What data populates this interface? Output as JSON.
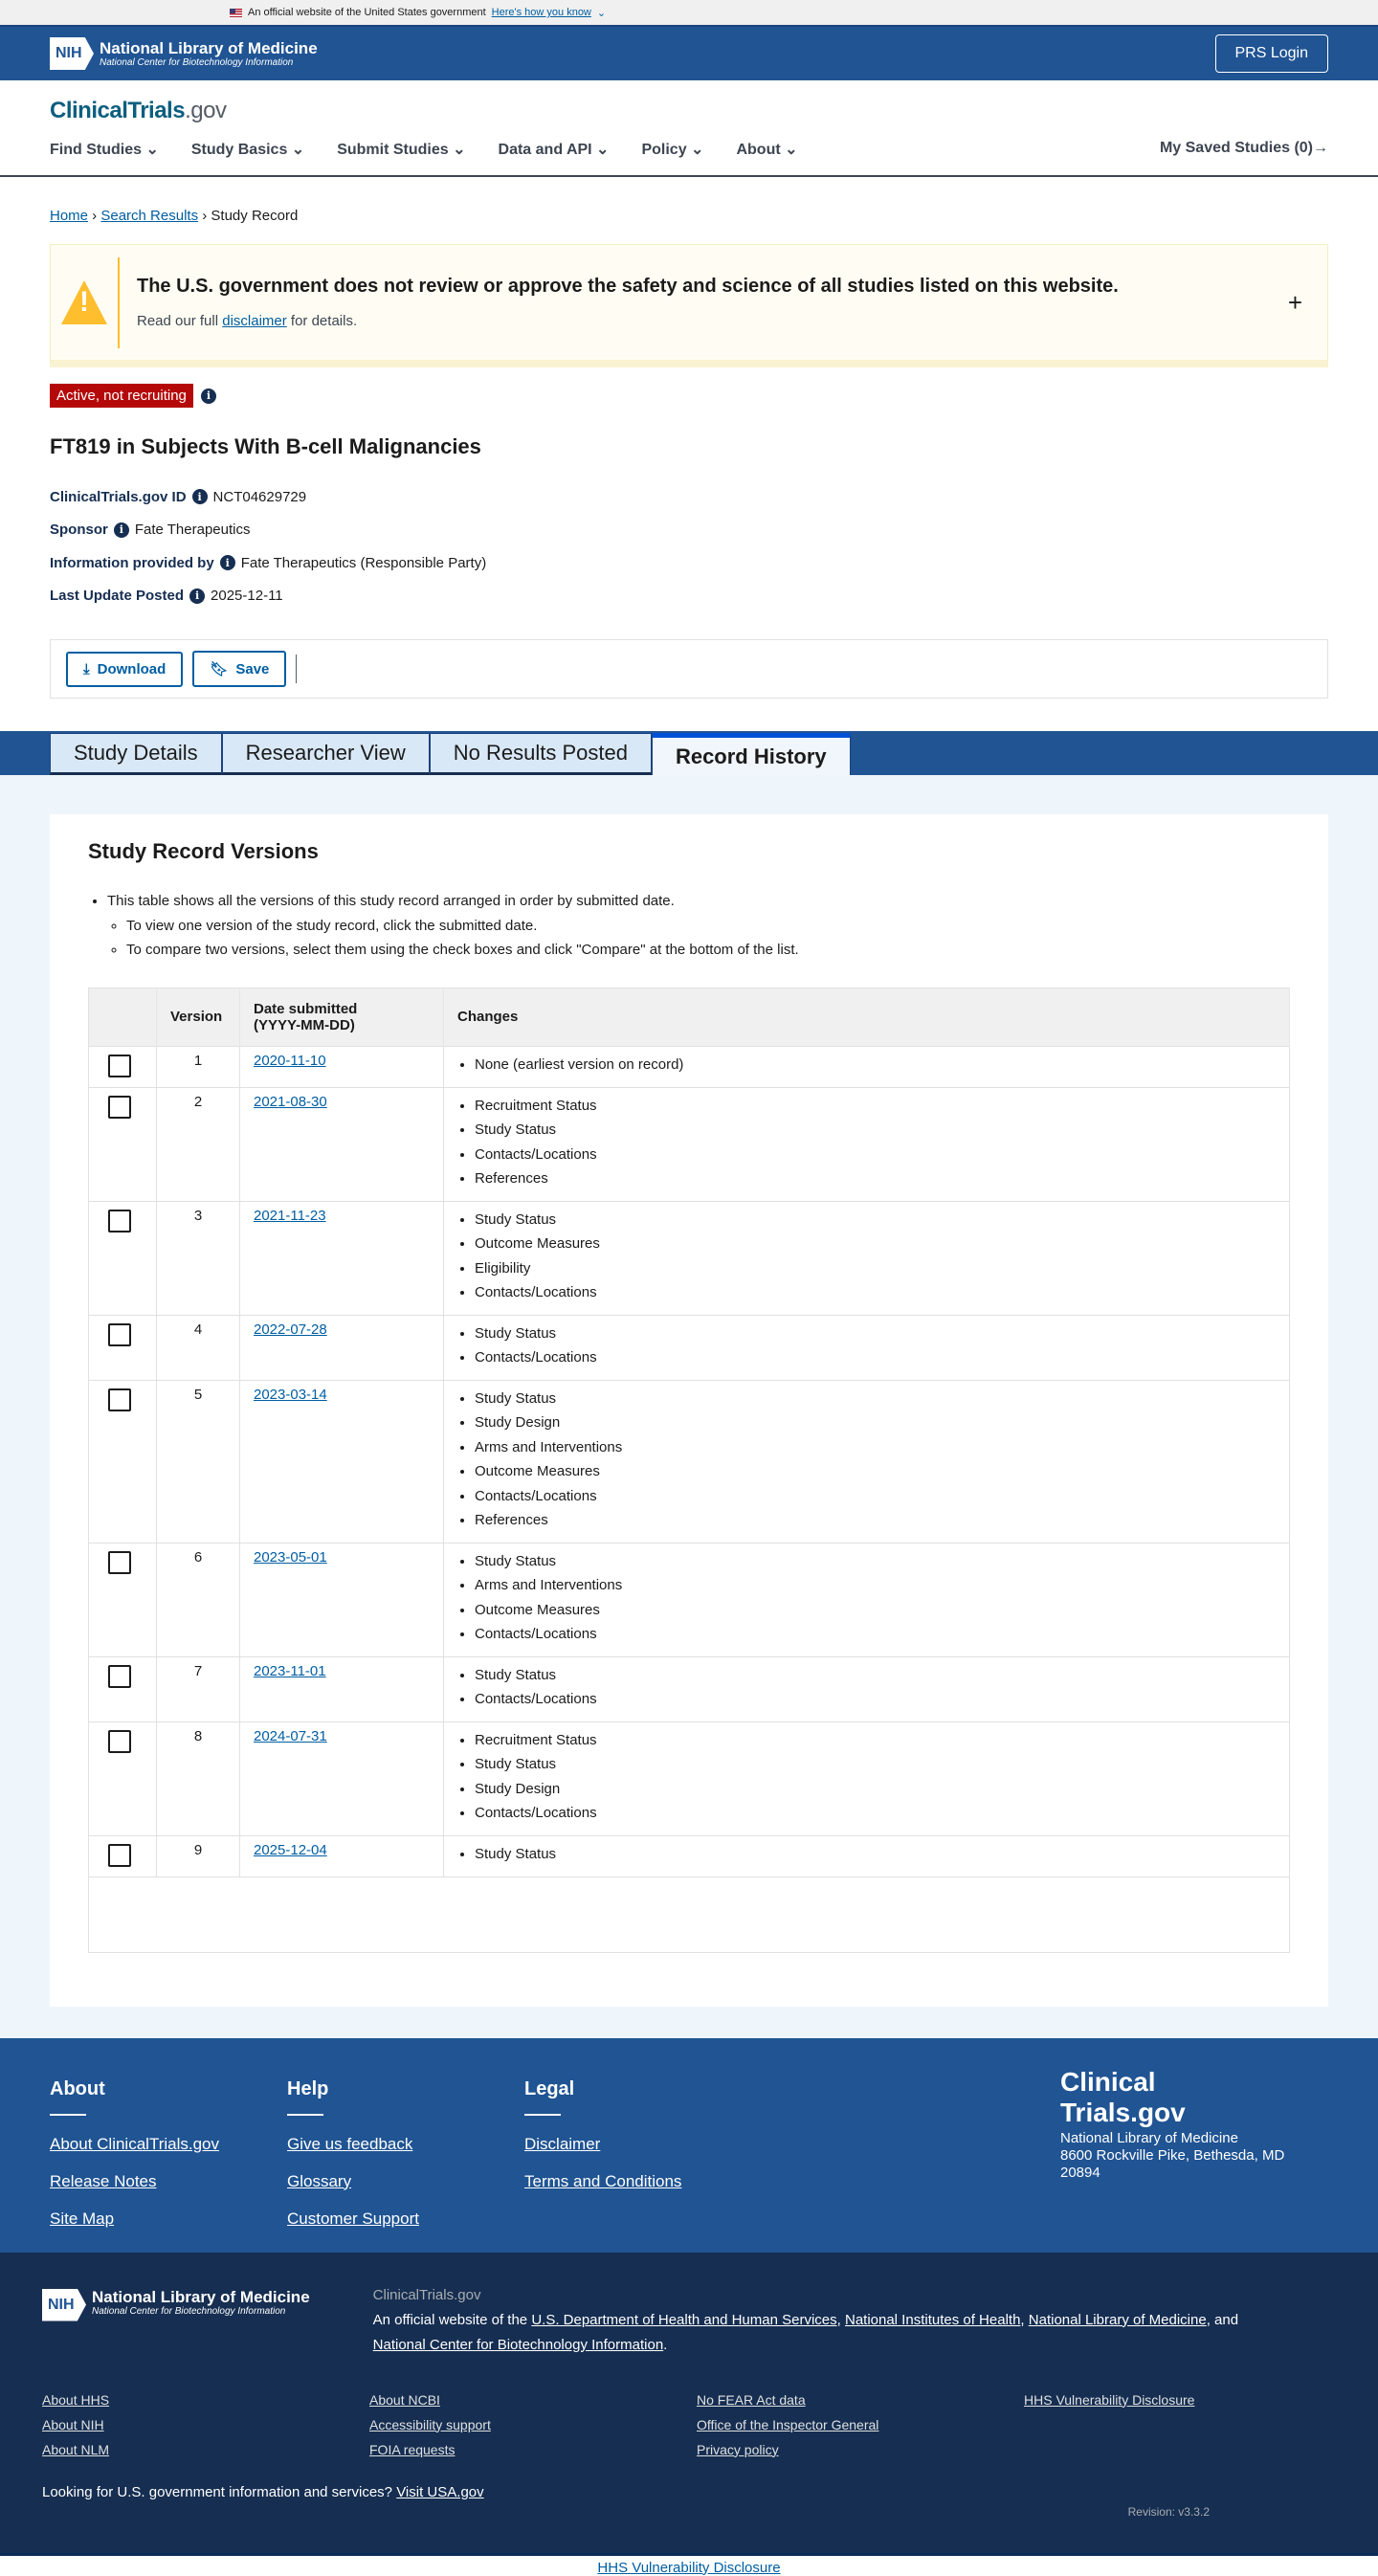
{
  "gov_banner": {
    "text": "An official website of the United States government",
    "link": "Here's how you know"
  },
  "top": {
    "nih": "NIH",
    "org": "National Library of Medicine",
    "sub": "National Center for Biotechnology Information",
    "login": "PRS Login"
  },
  "header": {
    "logo_a": "ClinicalTrials",
    "logo_b": ".gov",
    "nav": [
      "Find Studies",
      "Study Basics",
      "Submit Studies",
      "Data and API",
      "Policy",
      "About"
    ],
    "saved": "My Saved Studies (0)"
  },
  "breadcrumb": [
    "Home",
    "Search Results",
    "Study Record"
  ],
  "alert": {
    "title": "The U.S. government does not review or approve the safety and science of all studies listed on this website.",
    "pre": "Read our full",
    "link": "disclaimer",
    "post": "for details."
  },
  "status": "Active, not recruiting",
  "title": "FT819 in Subjects With B-cell Malignancies",
  "fields": [
    {
      "k": "ClinicalTrials.gov ID",
      "v": "NCT04629729"
    },
    {
      "k": "Sponsor",
      "v": "Fate Therapeutics"
    },
    {
      "k": "Information provided by",
      "v": "Fate Therapeutics (Responsible Party)"
    },
    {
      "k": "Last Update Posted",
      "v": "2025-12-11"
    }
  ],
  "actions": {
    "download": "Download",
    "save": "Save"
  },
  "tabs": [
    "Study Details",
    "Researcher View",
    "No Results Posted",
    "Record History"
  ],
  "versions": {
    "heading": "Study Record Versions",
    "bullet": "This table shows all the versions of this study record arranged in order by submitted date.",
    "sub1": "To view one version of the study record, click the submitted date.",
    "sub2": "To compare two versions, select them using the check boxes and click \"Compare\" at the bottom of the list.",
    "headers": [
      "Version",
      "Date submitted",
      "(YYYY-MM-DD)",
      "Changes"
    ],
    "rows": [
      {
        "v": "1",
        "d": "2020-11-10",
        "c": [
          "None (earliest version on record)"
        ]
      },
      {
        "v": "2",
        "d": "2021-08-30",
        "c": [
          "Recruitment Status",
          "Study Status",
          "Contacts/Locations",
          "References"
        ]
      },
      {
        "v": "3",
        "d": "2021-11-23",
        "c": [
          "Study Status",
          "Outcome Measures",
          "Eligibility",
          "Contacts/Locations"
        ]
      },
      {
        "v": "4",
        "d": "2022-07-28",
        "c": [
          "Study Status",
          "Contacts/Locations"
        ]
      },
      {
        "v": "5",
        "d": "2023-03-14",
        "c": [
          "Study Status",
          "Study Design",
          "Arms and Interventions",
          "Outcome Measures",
          "Contacts/Locations",
          "References"
        ]
      },
      {
        "v": "6",
        "d": "2023-05-01",
        "c": [
          "Study Status",
          "Arms and Interventions",
          "Outcome Measures",
          "Contacts/Locations"
        ]
      },
      {
        "v": "7",
        "d": "2023-11-01",
        "c": [
          "Study Status",
          "Contacts/Locations"
        ]
      },
      {
        "v": "8",
        "d": "2024-07-31",
        "c": [
          "Recruitment Status",
          "Study Status",
          "Study Design",
          "Contacts/Locations"
        ]
      },
      {
        "v": "9",
        "d": "2025-12-04",
        "c": [
          "Study Status"
        ]
      }
    ]
  },
  "footer": {
    "cols": [
      {
        "h": "About",
        "links": [
          "About ClinicalTrials.gov",
          "Release Notes",
          "Site Map"
        ]
      },
      {
        "h": "Help",
        "links": [
          "Give us feedback",
          "Glossary",
          "Customer Support"
        ]
      },
      {
        "h": "Legal",
        "links": [
          "Disclaimer",
          "Terms and Conditions"
        ]
      }
    ],
    "brand1": "Clinical",
    "brand2": "Trials.gov",
    "addr1": "National Library of Medicine",
    "addr2": "8600 Rockville Pike, Bethesda, MD 20894",
    "site": "ClinicalTrials.gov",
    "official": "An official website of the",
    "hhs": "U.S. Department of Health and Human Services",
    "nihl": "National Institutes of Health",
    "nlm": "National Library of Medicine",
    "and": "and",
    "ncbi": "National Center for Biotechnology Information",
    "links": [
      "About HHS",
      "About NCBI",
      "No FEAR Act data",
      "HHS Vulnerability Disclosure",
      "About NIH",
      "Accessibility support",
      "Office of the Inspector General",
      "",
      "About NLM",
      "FOIA requests",
      "Privacy policy",
      ""
    ],
    "usa_q": "Looking for U.S. government information and services?",
    "usa_link": "Visit USA.gov",
    "revision": "Revision: v3.3.2",
    "bottom_link": "HHS Vulnerability Disclosure"
  }
}
